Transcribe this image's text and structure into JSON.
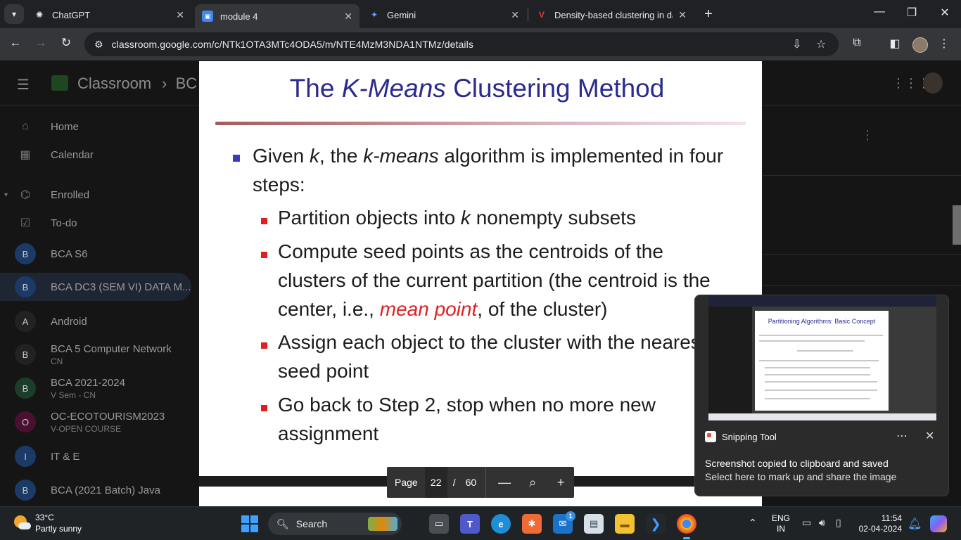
{
  "browser": {
    "tabs": [
      {
        "title": "ChatGPT",
        "icon": "chatgpt-icon"
      },
      {
        "title": "module 4",
        "icon": "classroom-icon",
        "active": true
      },
      {
        "title": "Gemini",
        "icon": "gemini-icon"
      },
      {
        "title": "Density-based clustering in data",
        "icon": "v-icon"
      }
    ],
    "url": "classroom.google.com/c/NTk1OTA3MTc4ODA5/m/NTE4MzM3NDA1NTMz/details"
  },
  "classroom": {
    "app_title": "Classroom",
    "breadcrumb": "BC",
    "nav": [
      {
        "label": "Home",
        "icon": "home-icon"
      },
      {
        "label": "Calendar",
        "icon": "calendar-icon"
      },
      {
        "label": "Enrolled",
        "icon": "school-icon"
      },
      {
        "label": "To-do",
        "icon": "todo-icon"
      }
    ],
    "classes": [
      {
        "initial": "B",
        "name": "BCA S6",
        "sub": "",
        "color": "#1c3a66"
      },
      {
        "initial": "B",
        "name": "BCA DC3 (SEM VI) DATA M...",
        "sub": "",
        "color": "#1c3a66"
      },
      {
        "initial": "A",
        "name": "Android",
        "sub": "",
        "color": "#222"
      },
      {
        "initial": "B",
        "name": "BCA 5 Computer Network",
        "sub": "CN",
        "color": "#222"
      },
      {
        "initial": "B",
        "name": "BCA 2021-2024",
        "sub": "V Sem - CN",
        "color": "#1b3d2a"
      },
      {
        "initial": "O",
        "name": "OC-ECOTOURISM2023",
        "sub": "V-OPEN COURSE",
        "color": "#4a1030"
      },
      {
        "initial": "I",
        "name": "IT & E",
        "sub": "",
        "color": "#1c3a66"
      },
      {
        "initial": "B",
        "name": "BCA (2021 Batch) Java",
        "sub": "",
        "color": "#1c3a66"
      }
    ]
  },
  "slide": {
    "title_pre": "The",
    "title_em": "K-Means",
    "title_post": "Clustering Method",
    "intro_a": "Given",
    "intro_k": "k",
    "intro_b": ", the",
    "intro_km": "k-means",
    "intro_c": "algorithm is implemented in four steps:",
    "step1_a": "Partition objects into",
    "step1_k": "k",
    "step1_b": "nonempty subsets",
    "step2_a": "Compute seed points as the centroids of the clusters of the current partition (the centroid is the center, i.e.,",
    "step2_red": "mean point",
    "step2_b": ", of the cluster)",
    "step3": "Assign each object to the cluster with the nearest seed point",
    "step4": "Go back to Step 2, stop when no more new assignment"
  },
  "pager": {
    "label": "Page",
    "current": "22",
    "sep": "/",
    "total": "60"
  },
  "toast": {
    "app": "Snipping Tool",
    "thumb_title": "Partitioning Algorithms: Basic Concept",
    "heading": "Screenshot copied to clipboard and saved",
    "body": "Select here to mark up and share the image"
  },
  "taskbar": {
    "temperature": "33°C",
    "condition": "Partly sunny",
    "search_label": "Search",
    "lang_1": "ENG",
    "lang_2": "IN",
    "time": "11:54",
    "date": "02-04-2024",
    "mail_badge": "1"
  }
}
